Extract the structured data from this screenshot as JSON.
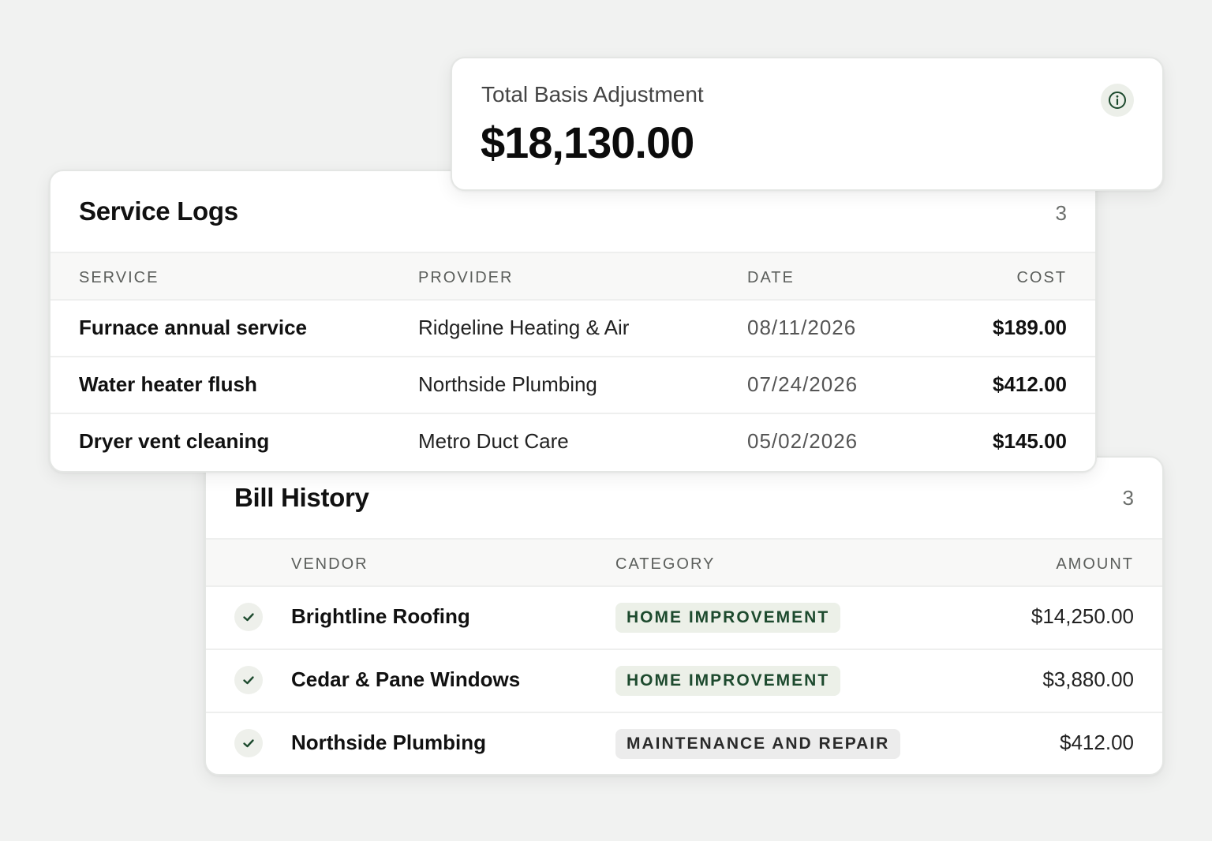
{
  "total": {
    "label": "Total Basis Adjustment",
    "value": "$18,130.00",
    "info_icon": "info-icon"
  },
  "service_logs": {
    "title": "Service Logs",
    "count": "3",
    "columns": [
      "SERVICE",
      "PROVIDER",
      "DATE",
      "COST"
    ],
    "rows": [
      {
        "service": "Furnace annual service",
        "provider": "Ridgeline Heating & Air",
        "date": "08/11/2026",
        "cost": "$189.00"
      },
      {
        "service": "Water heater flush",
        "provider": "Northside Plumbing",
        "date": "07/24/2026",
        "cost": "$412.00"
      },
      {
        "service": "Dryer vent cleaning",
        "provider": "Metro Duct Care",
        "date": "05/02/2026",
        "cost": "$145.00"
      }
    ]
  },
  "bill_history": {
    "title": "Bill History",
    "count": "3",
    "columns": [
      "VENDOR",
      "CATEGORY",
      "AMOUNT"
    ],
    "rows": [
      {
        "vendor": "Brightline Roofing",
        "category": "HOME IMPROVEMENT",
        "category_style": "green",
        "amount": "$14,250.00",
        "status_icon": "check-icon"
      },
      {
        "vendor": "Cedar & Pane Windows",
        "category": "HOME IMPROVEMENT",
        "category_style": "green",
        "amount": "$3,880.00",
        "status_icon": "check-icon"
      },
      {
        "vendor": "Northside Plumbing",
        "category": "MAINTENANCE AND REPAIR",
        "category_style": "gray",
        "amount": "$412.00",
        "status_icon": "check-icon"
      }
    ]
  },
  "colors": {
    "background": "#f1f2f1",
    "accent_green": "#1d4a2e",
    "badge_green_bg": "#ecf0e8",
    "badge_gray_bg": "#ececec"
  }
}
